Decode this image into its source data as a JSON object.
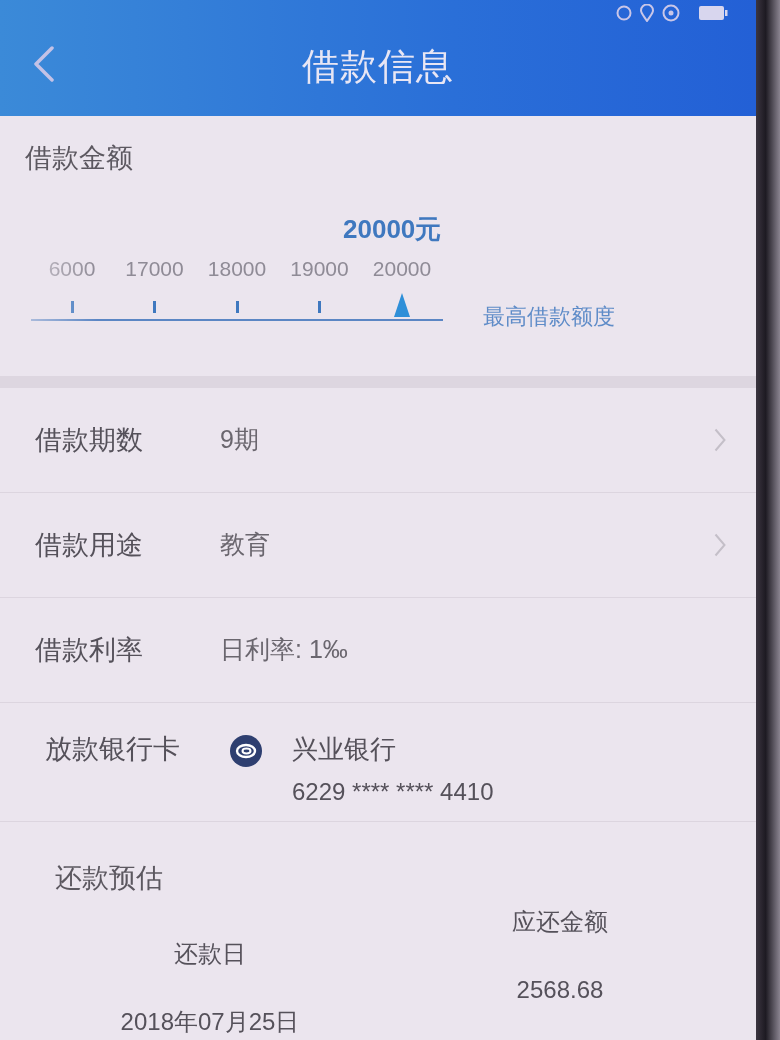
{
  "header": {
    "title": "借款信息"
  },
  "amount": {
    "label": "借款金额",
    "value": "20000元",
    "ticks": [
      {
        "label": "6000",
        "selected": false
      },
      {
        "label": "17000",
        "selected": false
      },
      {
        "label": "18000",
        "selected": false
      },
      {
        "label": "19000",
        "selected": false
      },
      {
        "label": "20000",
        "selected": true
      }
    ],
    "max_label": "最高借款额度"
  },
  "rows": [
    {
      "label": "借款期数",
      "value": "9期",
      "kind": "link"
    },
    {
      "label": "借款用途",
      "value": "教育",
      "kind": "link"
    },
    {
      "label": "借款利率",
      "value": "日利率: 1‰",
      "kind": "plain"
    }
  ],
  "bank": {
    "label": "放款银行卡",
    "name": "兴业银行",
    "number": "6229 **** **** 4410"
  },
  "estimate": {
    "label": "还款预估",
    "columns": [
      {
        "heading": "还款日",
        "value": "2018年07月25日"
      },
      {
        "heading": "应还金额",
        "value": "2568.68"
      }
    ]
  }
}
